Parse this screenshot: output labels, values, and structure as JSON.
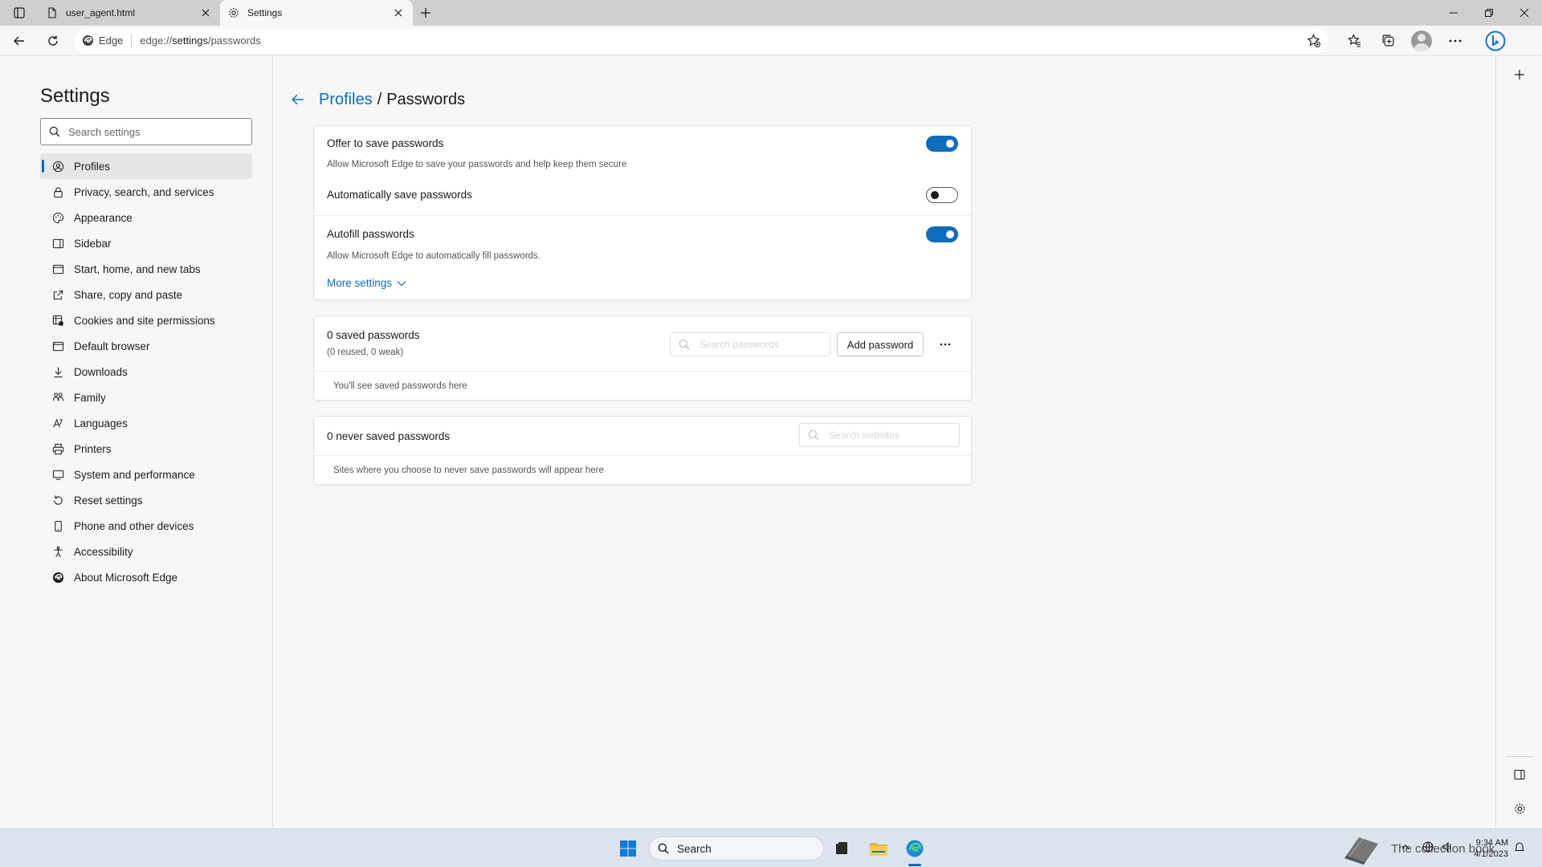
{
  "tabs": [
    {
      "title": "user_agent.html",
      "active": false
    },
    {
      "title": "Settings",
      "active": true
    }
  ],
  "toolbar": {
    "site_label": "Edge",
    "url_prefix": "edge://",
    "url_host": "settings",
    "url_path": "/passwords"
  },
  "nav": {
    "title": "Settings",
    "search_placeholder": "Search settings",
    "items": [
      {
        "label": "Profiles",
        "icon": "profile-icon",
        "active": true
      },
      {
        "label": "Privacy, search, and services",
        "icon": "lock-icon"
      },
      {
        "label": "Appearance",
        "icon": "appearance-icon"
      },
      {
        "label": "Sidebar",
        "icon": "sidebar-icon"
      },
      {
        "label": "Start, home, and new tabs",
        "icon": "home-icon"
      },
      {
        "label": "Share, copy and paste",
        "icon": "share-icon"
      },
      {
        "label": "Cookies and site permissions",
        "icon": "cookies-icon"
      },
      {
        "label": "Default browser",
        "icon": "browser-icon"
      },
      {
        "label": "Downloads",
        "icon": "download-icon"
      },
      {
        "label": "Family",
        "icon": "family-icon"
      },
      {
        "label": "Languages",
        "icon": "language-icon"
      },
      {
        "label": "Printers",
        "icon": "printer-icon"
      },
      {
        "label": "System and performance",
        "icon": "system-icon"
      },
      {
        "label": "Reset settings",
        "icon": "reset-icon"
      },
      {
        "label": "Phone and other devices",
        "icon": "phone-icon"
      },
      {
        "label": "Accessibility",
        "icon": "accessibility-icon"
      },
      {
        "label": "About Microsoft Edge",
        "icon": "edge-icon"
      }
    ]
  },
  "breadcrumb": {
    "parent": "Profiles",
    "separator": "/",
    "current": "Passwords"
  },
  "settings": {
    "offer_save": {
      "title": "Offer to save passwords",
      "desc": "Allow Microsoft Edge to save your passwords and help keep them secure",
      "enabled": true
    },
    "auto_save": {
      "title": "Automatically save passwords",
      "enabled": false
    },
    "autofill": {
      "title": "Autofill passwords",
      "desc": "Allow Microsoft Edge to automatically fill passwords.",
      "enabled": true
    },
    "more_settings": "More settings"
  },
  "saved": {
    "title": "0 saved passwords",
    "subtitle": "(0 reused, 0 weak)",
    "search_placeholder": "Search passwords",
    "add_label": "Add password",
    "empty": "You'll see saved passwords here"
  },
  "never_saved": {
    "title": "0 never saved passwords",
    "search_placeholder": "Search websites",
    "empty": "Sites where you choose to never save passwords will appear here"
  },
  "taskbar": {
    "search_label": "Search",
    "time": "9:34 AM",
    "date": "4/1/2023",
    "watermark": "The collection book"
  },
  "colors": {
    "accent": "#0f6cbd",
    "taskbar": "#dce4ee"
  }
}
